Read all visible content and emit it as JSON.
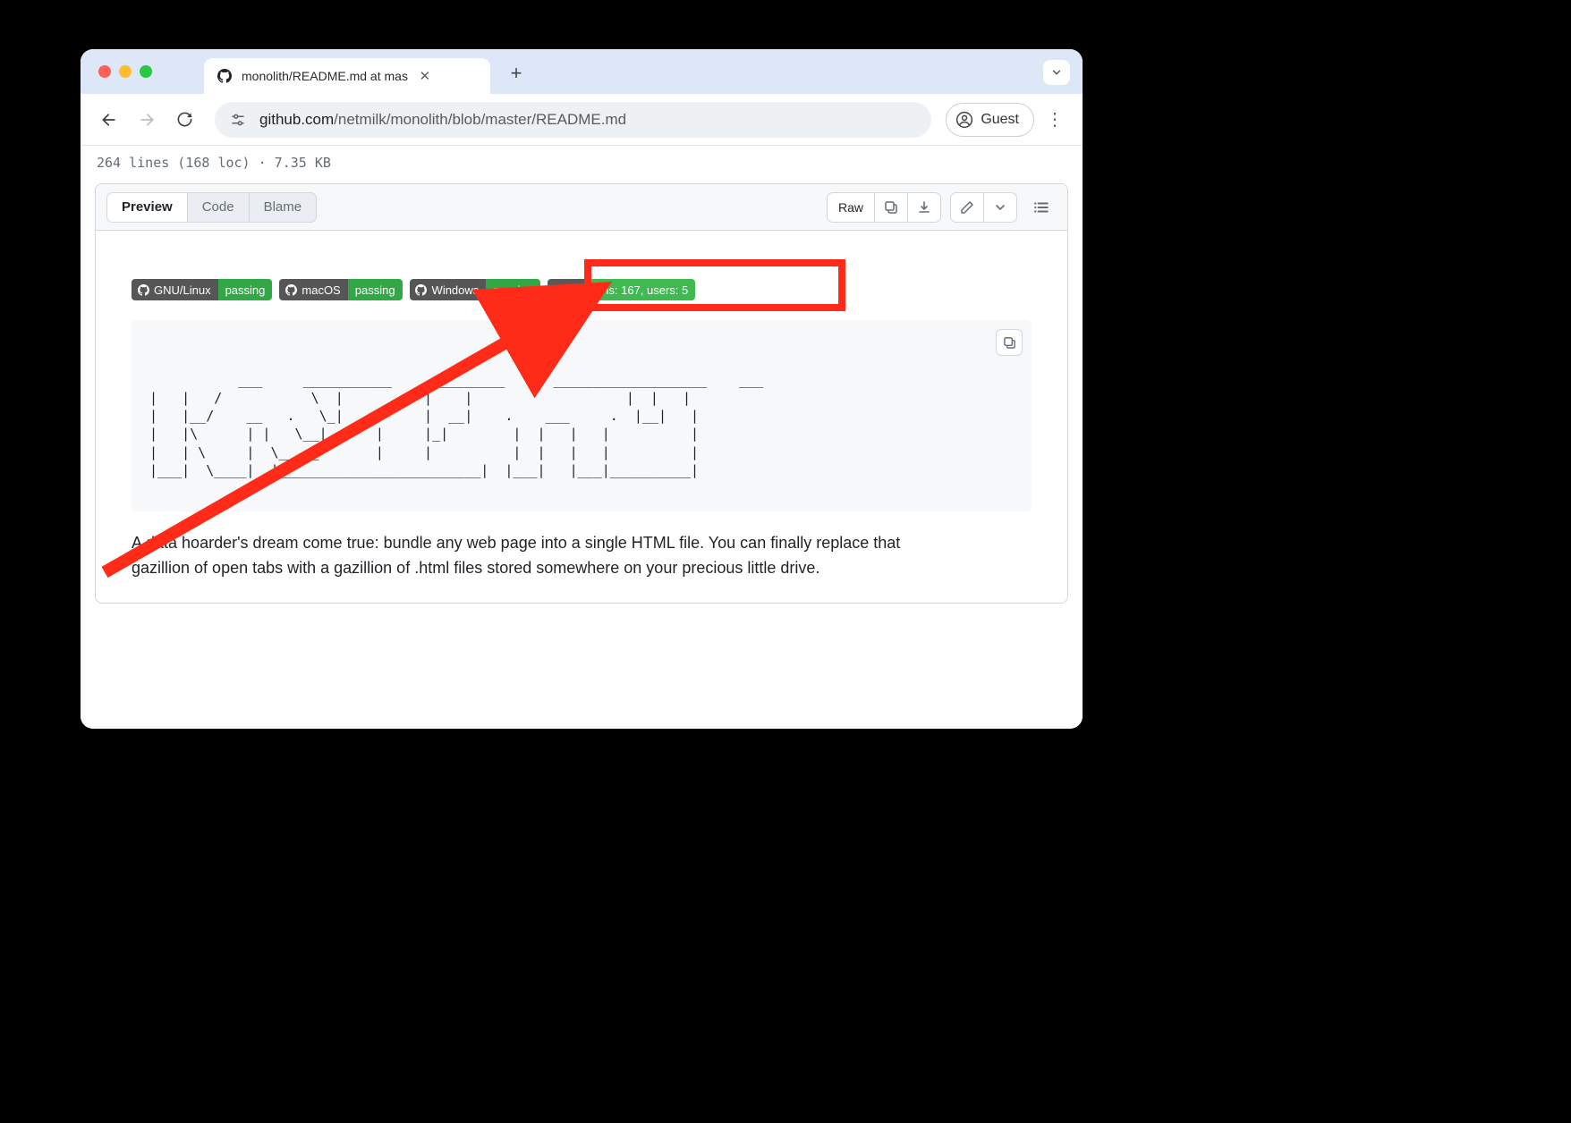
{
  "browser": {
    "tab_title": "monolith/README.md at mas",
    "new_tab_glyph": "+",
    "url_domain": "github.com",
    "url_path": "/netmilk/monolith/blob/master/README.md",
    "guest_label": "Guest"
  },
  "file_stats": "264 lines (168 loc) · 7.35 KB",
  "segmented": {
    "preview": "Preview",
    "code": "Code",
    "blame": "Blame"
  },
  "actions": {
    "raw": "Raw"
  },
  "badges": [
    {
      "label": "GNU/Linux",
      "status": "passing",
      "icon": "github"
    },
    {
      "label": "macOS",
      "status": "passing",
      "icon": "github"
    },
    {
      "label": "Windows",
      "status": "passing",
      "icon": "github"
    },
    {
      "label": "apify",
      "status": "runs: 167, users: 5",
      "icon": "none",
      "variant": "apify"
    }
  ],
  "ascii": " ___     ___________    __________      ___________________    ___\n|   |   /           \\  |          |    |                   |  |   |\n|   |__/    __   .   \\_|    .     |  __|    .    ___     .  |__|   |\n|   |\\      | |   \\__|      |     |_|        |  |   |   |          |\n|   | \\     |  \\_____       |     |          |  |   |   |          |\n|___|  \\____|  |_________________________|  |___|   |___|__________|",
  "description": "A data hoarder's dream come true: bundle any web page into a single HTML file. You can finally replace that gazillion of open tabs with a gazillion of .html files stored somewhere on your precious little drive."
}
